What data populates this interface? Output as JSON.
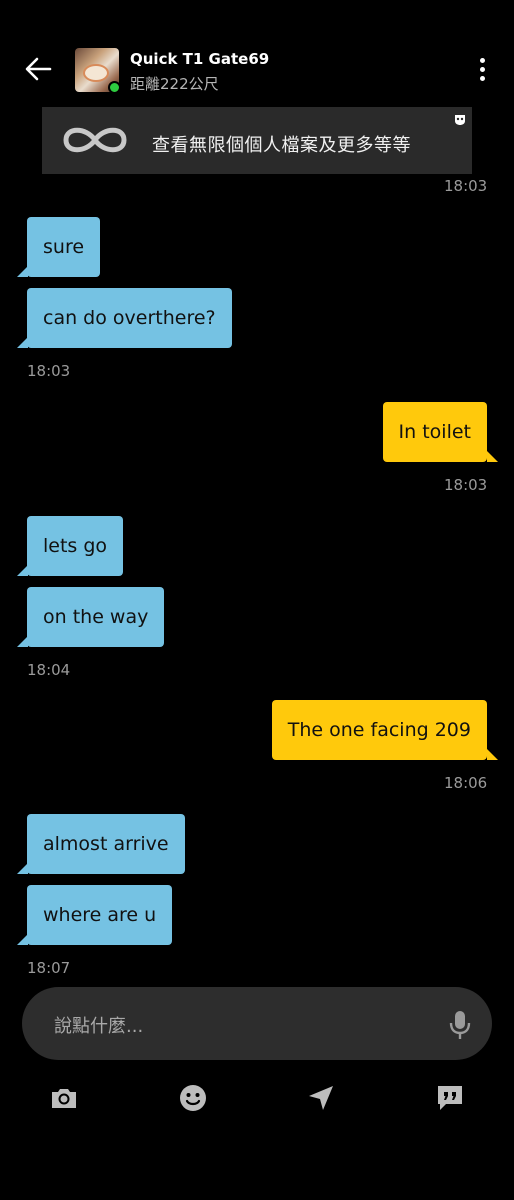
{
  "header": {
    "name": "Quick T1 Gate69",
    "distance": "距離222公尺"
  },
  "banner": {
    "text": "查看無限個個人檔案及更多等等",
    "timestamp": "18:03"
  },
  "messages": [
    {
      "text": "sure"
    },
    {
      "text": "can do overthere?"
    },
    {
      "ts": "18:03"
    },
    {
      "text": "In toilet"
    },
    {
      "ts": "18:03"
    },
    {
      "text": "lets go"
    },
    {
      "text": "on the way"
    },
    {
      "ts": "18:04"
    },
    {
      "text": "The one facing 209"
    },
    {
      "ts": "18:06"
    },
    {
      "text": "almost arrive"
    },
    {
      "text": "where are u"
    },
    {
      "ts": "18:07"
    }
  ],
  "composer": {
    "placeholder": "說點什麼..."
  },
  "colors": {
    "received_bubble": "#75c2e3",
    "sent_bubble": "#ffc90c",
    "online": "#2ecc40"
  },
  "icons": [
    "back-arrow-icon",
    "more-vert-icon",
    "infinity-icon",
    "mask-icon",
    "mic-icon",
    "camera-icon",
    "smiley-icon",
    "location-arrow-icon",
    "quote-bubble-icon"
  ]
}
